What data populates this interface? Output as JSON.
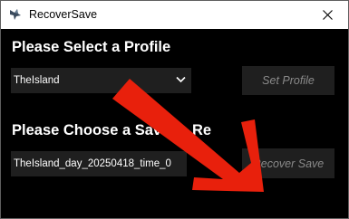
{
  "window": {
    "title": "RecoverSave",
    "close_icon": "close-icon",
    "app_icon": "bird-app-icon"
  },
  "profile_section": {
    "label": "Please Select a Profile",
    "selected_profile": "TheIsland",
    "set_button_label": "Set Profile"
  },
  "save_section": {
    "label": "Please Choose a Save to Re",
    "selected_save": "TheIsland_day_20250418_time_0",
    "recover_button_label": "Recover Save"
  },
  "annotation": {
    "arrow_color": "#e8200c",
    "arrow_target": "recover-save-button"
  },
  "colors": {
    "background": "#000000",
    "control_bg": "#1f1f1f",
    "disabled_text": "#8a8a8a"
  }
}
